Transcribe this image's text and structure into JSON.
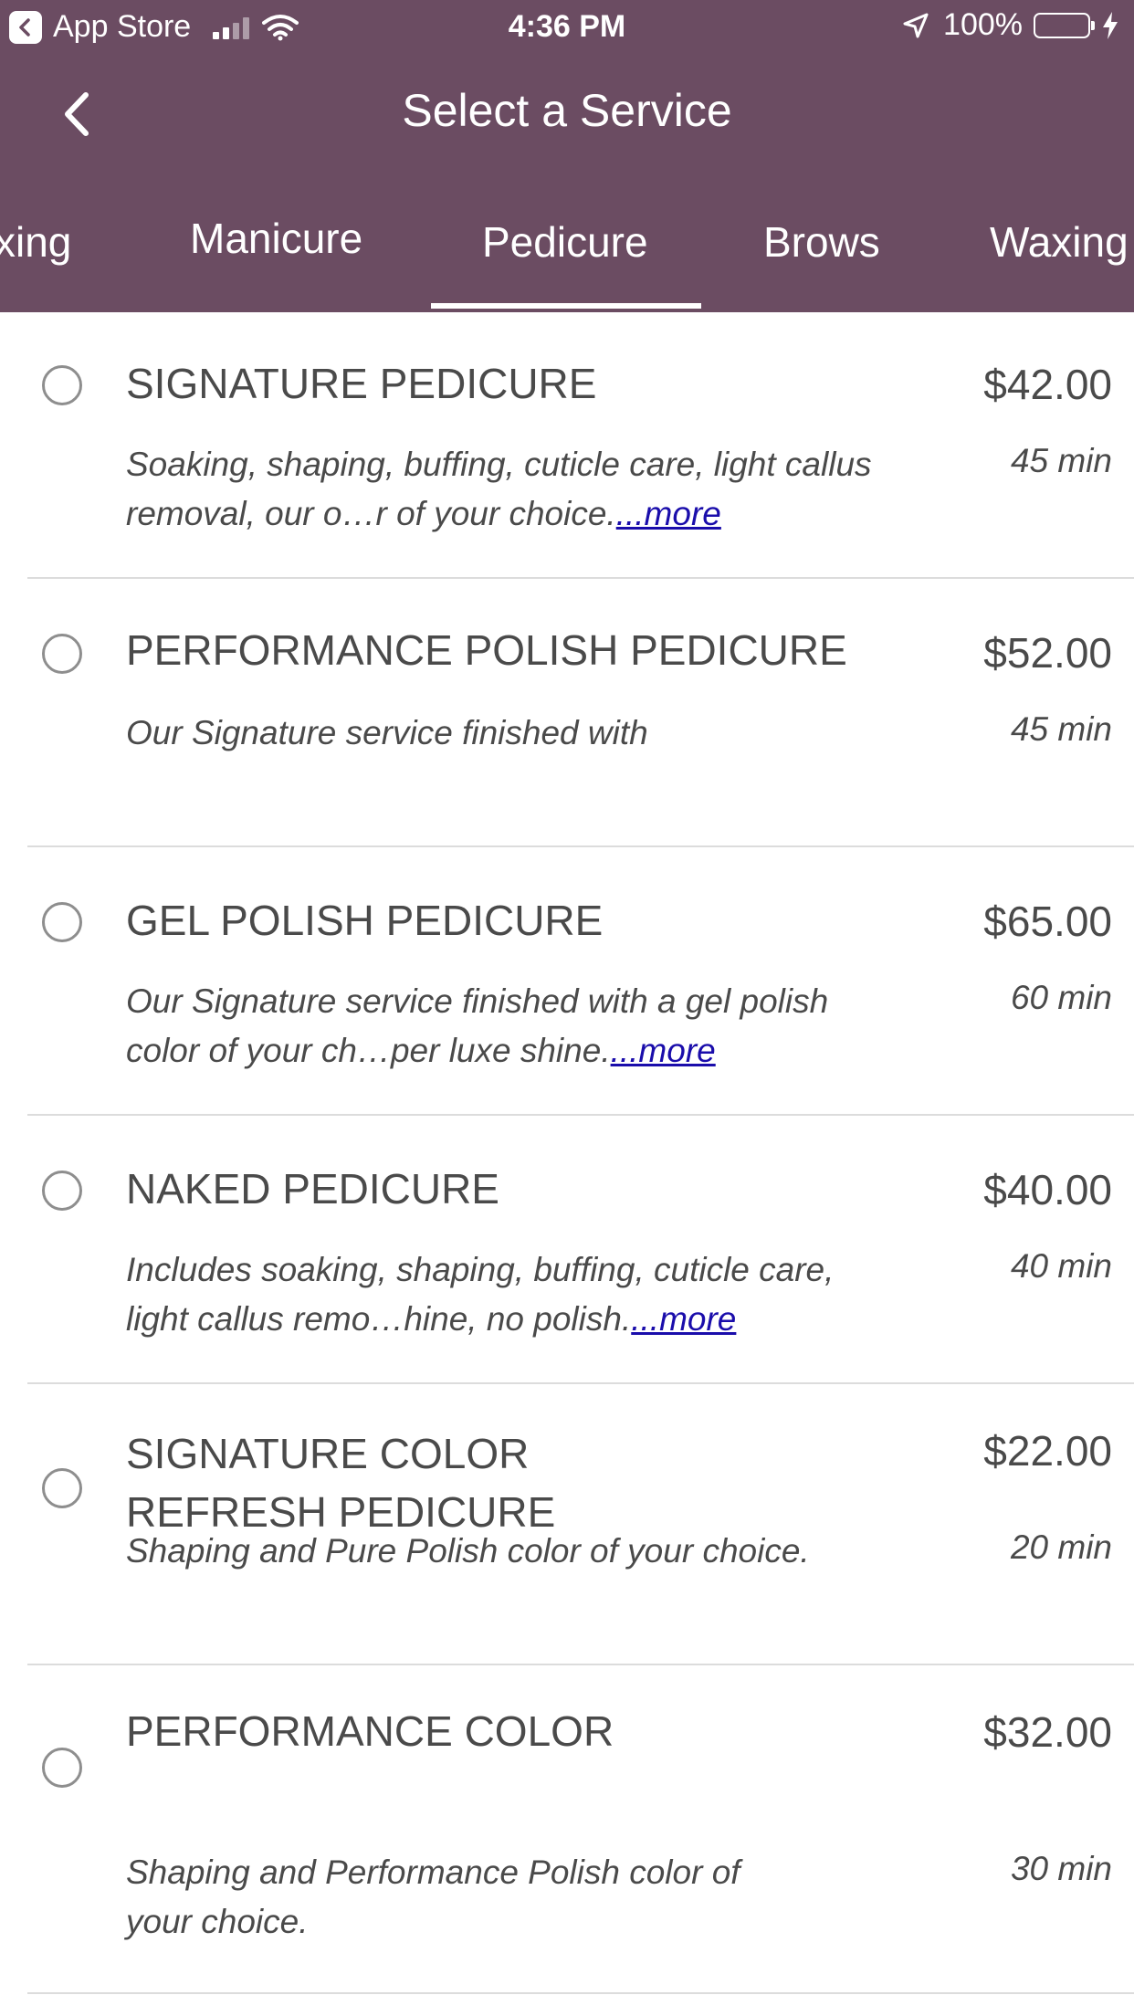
{
  "status_bar": {
    "back_app": "App Store",
    "time": "4:36 PM",
    "battery": "100%"
  },
  "nav": {
    "title": "Select a Service"
  },
  "tabs": [
    "xing",
    "Manicure",
    "Pedicure",
    "Brows",
    "Waxing"
  ],
  "active_tab": "Pedicure",
  "colors": {
    "header_bg": "#6b4c62",
    "link": "#1a0dab",
    "battery": "#5fd35f"
  },
  "services": [
    {
      "name": "SIGNATURE PEDICURE",
      "price": "$42.00",
      "description": "Soaking, shaping, buffing, cuticle care, light callus removal, our o…r of your choice.",
      "more": "...more",
      "duration": "45 min"
    },
    {
      "name": "PERFORMANCE POLISH PEDICURE",
      "price": "$52.00",
      "description": "Our Signature service finished with",
      "duration": "45 min"
    },
    {
      "name": "GEL POLISH PEDICURE",
      "price": "$65.00",
      "description": "Our Signature service finished with a gel polish color of your ch…per luxe shine.",
      "more": "...more",
      "duration": "60 min"
    },
    {
      "name": "NAKED PEDICURE",
      "price": "$40.00",
      "description": "Includes soaking, shaping, buffing, cuticle care, light callus remo…hine, no polish.",
      "more": "...more",
      "duration": "40 min"
    },
    {
      "name": "SIGNATURE COLOR REFRESH PEDICURE",
      "price": "$22.00",
      "description": "Shaping and Pure Polish color of your choice.",
      "duration": "20 min"
    },
    {
      "name": "PERFORMANCE COLOR",
      "price": "$32.00",
      "description": "Shaping and Performance Polish color of your choice.",
      "duration": "30 min"
    }
  ]
}
